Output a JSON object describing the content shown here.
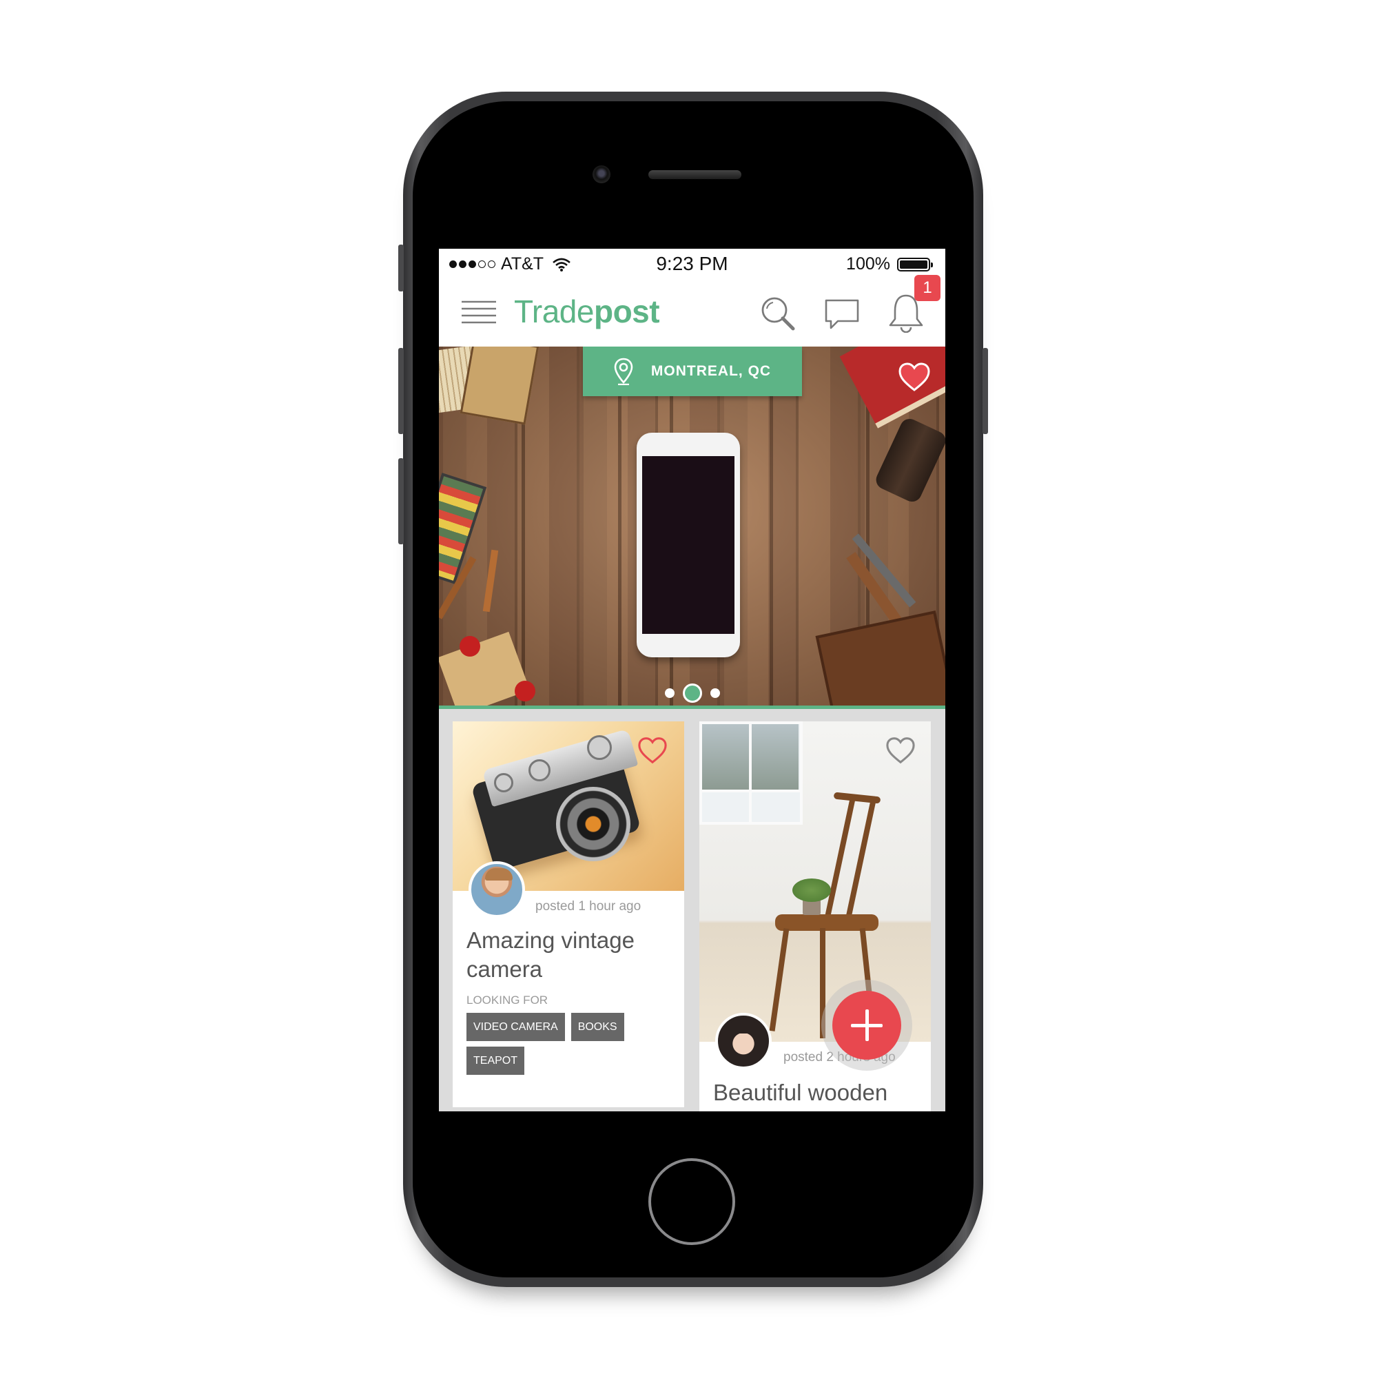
{
  "status_bar": {
    "carrier": "AT&T",
    "time": "9:23 PM",
    "battery": "100%",
    "battery_level": 1.0,
    "signal_bars_filled": 3,
    "signal_bars_total": 5
  },
  "header": {
    "logo_light": "Trade",
    "logo_bold": "post",
    "notification_count": "1",
    "icons": [
      "menu-icon",
      "search-icon",
      "chat-icon",
      "bell-icon"
    ]
  },
  "hero": {
    "location": "MONTREAL, QC",
    "carousel_pages": 3,
    "carousel_active": 2,
    "favorited": true
  },
  "listings": [
    {
      "posted": "posted 1 hour ago",
      "title": "Amazing vintage camera",
      "looking_for_label": "LOOKING FOR",
      "tags": [
        "VIDEO CAMERA",
        "BOOKS",
        "TEAPOT"
      ],
      "favorited": true
    },
    {
      "posted": "posted 2 hours ago",
      "title": "Beautiful wooden",
      "favorited": false
    }
  ],
  "colors": {
    "brand_green": "#5db486",
    "accent_red": "#e8484f",
    "tag_gray": "#676767",
    "feed_bg": "#dcdcdc"
  }
}
